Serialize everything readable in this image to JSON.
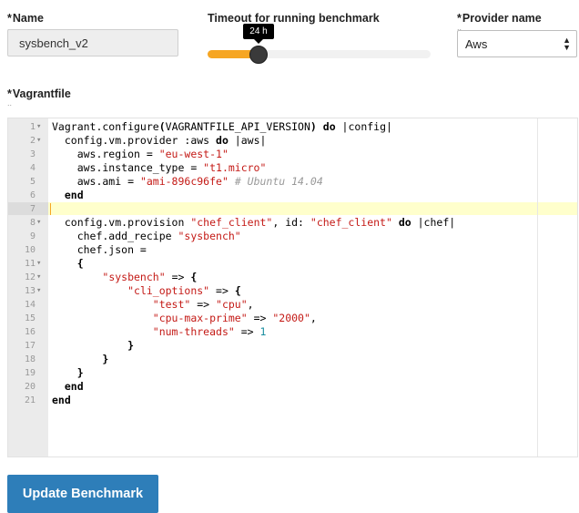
{
  "form": {
    "name_label": "Name",
    "name_value": "sysbench_v2",
    "timeout_label": "Timeout for running benchmark",
    "timeout_tooltip": "24 h",
    "timeout_fraction": 0.23,
    "provider_label": "Provider name",
    "provider_value": "Aws",
    "vagrantfile_label": "Vagrantfile",
    "required_marker": "*",
    "hint_marker": "..",
    "submit_label": "Update Benchmark"
  },
  "editor": {
    "active_line": 7,
    "lines": [
      {
        "n": "1",
        "fold": true,
        "html": "Vagrant.configure<span class='t-kw'>(</span>VAGRANTFILE_API_VERSION<span class='t-kw'>)</span> <span class='t-kw'>do</span> |config|"
      },
      {
        "n": "2",
        "fold": true,
        "html": "  config.vm.provider :aws <span class='t-kw'>do</span> |aws|"
      },
      {
        "n": "3",
        "fold": false,
        "html": "    aws.region = <span class='t-str'>\"eu-west-1\"</span>"
      },
      {
        "n": "4",
        "fold": false,
        "html": "    aws.instance_type = <span class='t-str'>\"t1.micro\"</span>"
      },
      {
        "n": "5",
        "fold": false,
        "html": "    aws.ami = <span class='t-str'>\"ami-896c96fe\"</span> <span class='t-cm'># Ubuntu 14.04</span>"
      },
      {
        "n": "6",
        "fold": false,
        "html": "  <span class='t-kw'>end</span>"
      },
      {
        "n": "7",
        "fold": false,
        "html": ""
      },
      {
        "n": "8",
        "fold": true,
        "html": "  config.vm.provision <span class='t-str'>\"chef_client\"</span>, id: <span class='t-str'>\"chef_client\"</span> <span class='t-kw'>do</span> |chef|"
      },
      {
        "n": "9",
        "fold": false,
        "html": "    chef.add_recipe <span class='t-str'>\"sysbench\"</span>"
      },
      {
        "n": "10",
        "fold": false,
        "html": "    chef.json ="
      },
      {
        "n": "11",
        "fold": true,
        "html": "    <span class='t-kw'>{</span>"
      },
      {
        "n": "12",
        "fold": true,
        "html": "        <span class='t-str'>\"sysbench\"</span> =&gt; <span class='t-kw'>{</span>"
      },
      {
        "n": "13",
        "fold": true,
        "html": "            <span class='t-str'>\"cli_options\"</span> =&gt; <span class='t-kw'>{</span>"
      },
      {
        "n": "14",
        "fold": false,
        "html": "                <span class='t-str'>\"test\"</span> =&gt; <span class='t-str'>\"cpu\"</span>,"
      },
      {
        "n": "15",
        "fold": false,
        "html": "                <span class='t-str'>\"cpu-max-prime\"</span> =&gt; <span class='t-str'>\"2000\"</span>,"
      },
      {
        "n": "16",
        "fold": false,
        "html": "                <span class='t-str'>\"num-threads\"</span> =&gt; <span class='t-num'>1</span>"
      },
      {
        "n": "17",
        "fold": false,
        "html": "            <span class='t-kw'>}</span>"
      },
      {
        "n": "18",
        "fold": false,
        "html": "        <span class='t-kw'>}</span>"
      },
      {
        "n": "19",
        "fold": false,
        "html": "    <span class='t-kw'>}</span>"
      },
      {
        "n": "20",
        "fold": false,
        "html": "  <span class='t-kw'>end</span>"
      },
      {
        "n": "21",
        "fold": false,
        "html": "<span class='t-kw'>end</span>"
      }
    ]
  }
}
